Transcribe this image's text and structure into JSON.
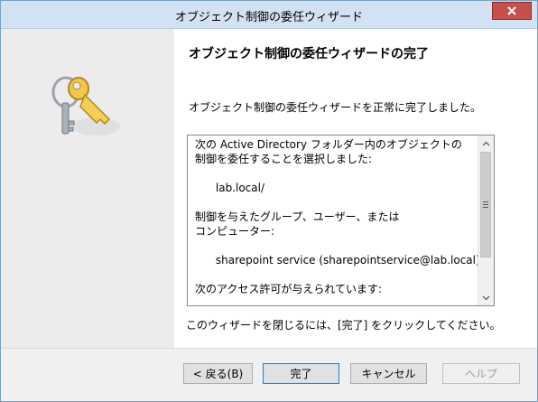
{
  "window": {
    "title": "オブジェクト制御の委任ウィザード",
    "close_glyph": "✕"
  },
  "page": {
    "heading": "オブジェクト制御の委任ウィザードの完了",
    "description": "オブジェクト制御の委任ウィザードを正常に完了しました。",
    "summary": "次の Active Directory フォルダー内のオブジェクトの\n制御を委任することを選択しました:\n\n      lab.local/\n\n制御を与えたグループ、ユーザー、または\nコンピューター:\n\n      sharepoint service (sharepointservice@lab.local)\n\n次のアクセス許可が与えられています:",
    "close_instruction": "このウィザードを閉じるには、[完了] をクリックしてください。"
  },
  "buttons": {
    "back": "< 戻る(B)",
    "finish": "完了",
    "cancel": "キャンセル",
    "help": "ヘルプ"
  },
  "icons": {
    "hero": "keys-icon",
    "scroll_up": "chevron-up-icon",
    "scroll_down": "chevron-down-icon"
  },
  "colors": {
    "title_bar": "#d2e2f2",
    "close_button": "#c7514a",
    "default_button_border": "#3c7fb1"
  }
}
